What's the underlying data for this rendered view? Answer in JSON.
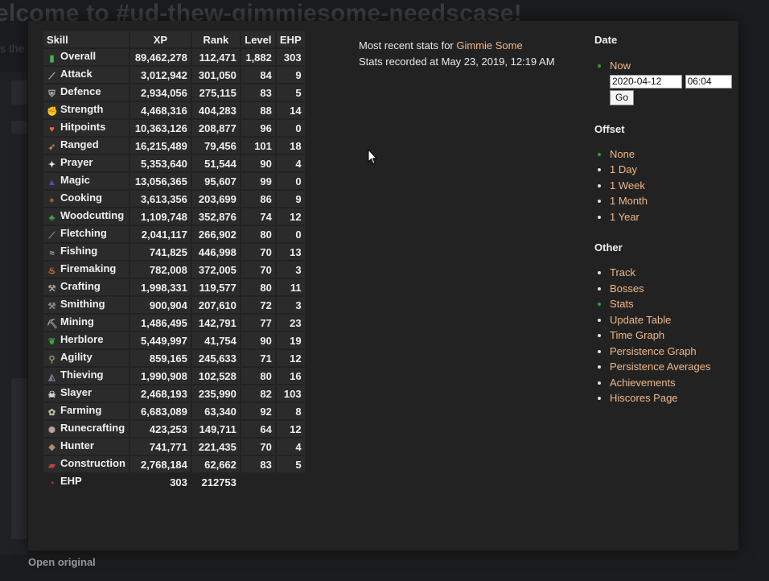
{
  "background": {
    "title": "elcome to #ud-thew-gimmiesome-needscase!",
    "subtitle": "s the",
    "open_original": "Open original"
  },
  "table": {
    "headers": [
      "Skill",
      "XP",
      "Rank",
      "Level",
      "EHP"
    ],
    "rows": [
      {
        "icon": "overall-icon",
        "skill": "Overall",
        "xp": "89,462,278",
        "rank": "112,471",
        "level": "1,882",
        "ehp": "303"
      },
      {
        "icon": "attack-icon",
        "skill": "Attack",
        "xp": "3,012,942",
        "rank": "301,050",
        "level": "84",
        "ehp": "9"
      },
      {
        "icon": "defence-icon",
        "skill": "Defence",
        "xp": "2,934,056",
        "rank": "275,115",
        "level": "83",
        "ehp": "5"
      },
      {
        "icon": "strength-icon",
        "skill": "Strength",
        "xp": "4,468,316",
        "rank": "404,283",
        "level": "88",
        "ehp": "14"
      },
      {
        "icon": "hitpoints-icon",
        "skill": "Hitpoints",
        "xp": "10,363,126",
        "rank": "208,877",
        "level": "96",
        "ehp": "0"
      },
      {
        "icon": "ranged-icon",
        "skill": "Ranged",
        "xp": "16,215,489",
        "rank": "79,456",
        "level": "101",
        "ehp": "18"
      },
      {
        "icon": "prayer-icon",
        "skill": "Prayer",
        "xp": "5,353,640",
        "rank": "51,544",
        "level": "90",
        "ehp": "4"
      },
      {
        "icon": "magic-icon",
        "skill": "Magic",
        "xp": "13,056,365",
        "rank": "95,607",
        "level": "99",
        "ehp": "0"
      },
      {
        "icon": "cooking-icon",
        "skill": "Cooking",
        "xp": "3,613,356",
        "rank": "203,699",
        "level": "86",
        "ehp": "9"
      },
      {
        "icon": "woodcutting-icon",
        "skill": "Woodcutting",
        "xp": "1,109,748",
        "rank": "352,876",
        "level": "74",
        "ehp": "12"
      },
      {
        "icon": "fletching-icon",
        "skill": "Fletching",
        "xp": "2,041,117",
        "rank": "266,902",
        "level": "80",
        "ehp": "0"
      },
      {
        "icon": "fishing-icon",
        "skill": "Fishing",
        "xp": "741,825",
        "rank": "446,998",
        "level": "70",
        "ehp": "13"
      },
      {
        "icon": "firemaking-icon",
        "skill": "Firemaking",
        "xp": "782,008",
        "rank": "372,005",
        "level": "70",
        "ehp": "3"
      },
      {
        "icon": "crafting-icon",
        "skill": "Crafting",
        "xp": "1,998,331",
        "rank": "119,577",
        "level": "80",
        "ehp": "11"
      },
      {
        "icon": "smithing-icon",
        "skill": "Smithing",
        "xp": "900,904",
        "rank": "207,610",
        "level": "72",
        "ehp": "3"
      },
      {
        "icon": "mining-icon",
        "skill": "Mining",
        "xp": "1,486,495",
        "rank": "142,791",
        "level": "77",
        "ehp": "23"
      },
      {
        "icon": "herblore-icon",
        "skill": "Herblore",
        "xp": "5,449,997",
        "rank": "41,754",
        "level": "90",
        "ehp": "19"
      },
      {
        "icon": "agility-icon",
        "skill": "Agility",
        "xp": "859,165",
        "rank": "245,633",
        "level": "71",
        "ehp": "12"
      },
      {
        "icon": "thieving-icon",
        "skill": "Thieving",
        "xp": "1,990,908",
        "rank": "102,528",
        "level": "80",
        "ehp": "16"
      },
      {
        "icon": "slayer-icon",
        "skill": "Slayer",
        "xp": "2,468,193",
        "rank": "235,990",
        "level": "82",
        "ehp": "103"
      },
      {
        "icon": "farming-icon",
        "skill": "Farming",
        "xp": "6,683,089",
        "rank": "63,340",
        "level": "92",
        "ehp": "8"
      },
      {
        "icon": "runecrafting-icon",
        "skill": "Runecrafting",
        "xp": "423,253",
        "rank": "149,711",
        "level": "64",
        "ehp": "12"
      },
      {
        "icon": "hunter-icon",
        "skill": "Hunter",
        "xp": "741,771",
        "rank": "221,435",
        "level": "70",
        "ehp": "4"
      },
      {
        "icon": "construction-icon",
        "skill": "Construction",
        "xp": "2,768,184",
        "rank": "62,662",
        "level": "83",
        "ehp": "5"
      }
    ],
    "ehp_row": {
      "icon": "ehp-icon",
      "skill": "EHP",
      "xp": "303",
      "rank": "212753"
    }
  },
  "info": {
    "line1_prefix": "Most recent stats for ",
    "player_name": "Gimmie Some",
    "line2": "Stats recorded at May 23, 2019, 12:19 AM"
  },
  "sidebar": {
    "date": {
      "heading": "Date",
      "now_label": "Now",
      "date_value": "2020-04-12",
      "time_value": "06:04",
      "go_label": "Go"
    },
    "offset": {
      "heading": "Offset",
      "items": [
        {
          "label": "None",
          "active": true
        },
        {
          "label": "1 Day",
          "active": false
        },
        {
          "label": "1 Week",
          "active": false
        },
        {
          "label": "1 Month",
          "active": false
        },
        {
          "label": "1 Year",
          "active": false
        }
      ]
    },
    "other": {
      "heading": "Other",
      "items": [
        {
          "label": "Track",
          "active": false
        },
        {
          "label": "Bosses",
          "active": false
        },
        {
          "label": "Stats",
          "active": true
        },
        {
          "label": "Update Table",
          "active": false
        },
        {
          "label": "Time Graph",
          "active": false
        },
        {
          "label": "Persistence Graph",
          "active": false
        },
        {
          "label": "Persistence Averages",
          "active": false
        },
        {
          "label": "Achievements",
          "active": false
        },
        {
          "label": "Hiscores Page",
          "active": false
        }
      ]
    }
  },
  "colors": {
    "link": "#f0b889",
    "active_bullet": "#2e9e3b",
    "cell_bg": "#2b2b2b",
    "modal_bg": "#222222"
  }
}
